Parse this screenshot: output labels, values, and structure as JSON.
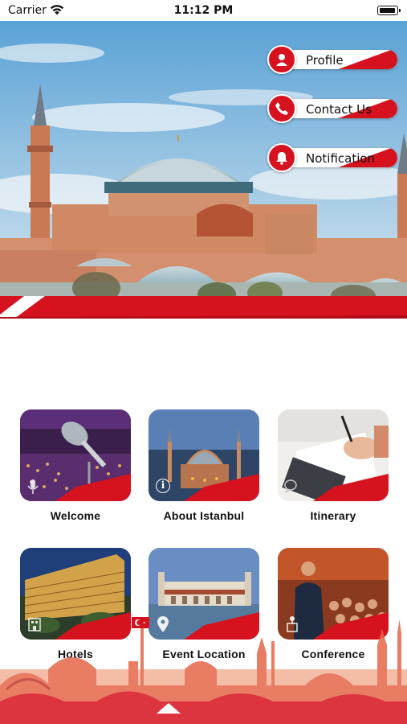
{
  "status_bar": {
    "carrier": "Carrier",
    "time": "11:12 PM"
  },
  "menu": [
    {
      "label": "Profile",
      "icon": "person-icon"
    },
    {
      "label": "Contact Us",
      "icon": "phone-icon"
    },
    {
      "label": "Notification",
      "icon": "bell-icon"
    }
  ],
  "tiles": [
    {
      "label": "Welcome",
      "icon": "microphone-icon"
    },
    {
      "label": "About Istanbul",
      "icon": "info-icon"
    },
    {
      "label": "Itinerary",
      "icon": "chat-icon"
    },
    {
      "label": "Hotels",
      "icon": "hotel-icon"
    },
    {
      "label": "Event Location",
      "icon": "location-pin-icon"
    },
    {
      "label": "Conference",
      "icon": "speaker-icon"
    }
  ],
  "colors": {
    "accent_red": "#d6121f",
    "sky_blue": "#7fb6dc",
    "background": "#ffffff"
  }
}
